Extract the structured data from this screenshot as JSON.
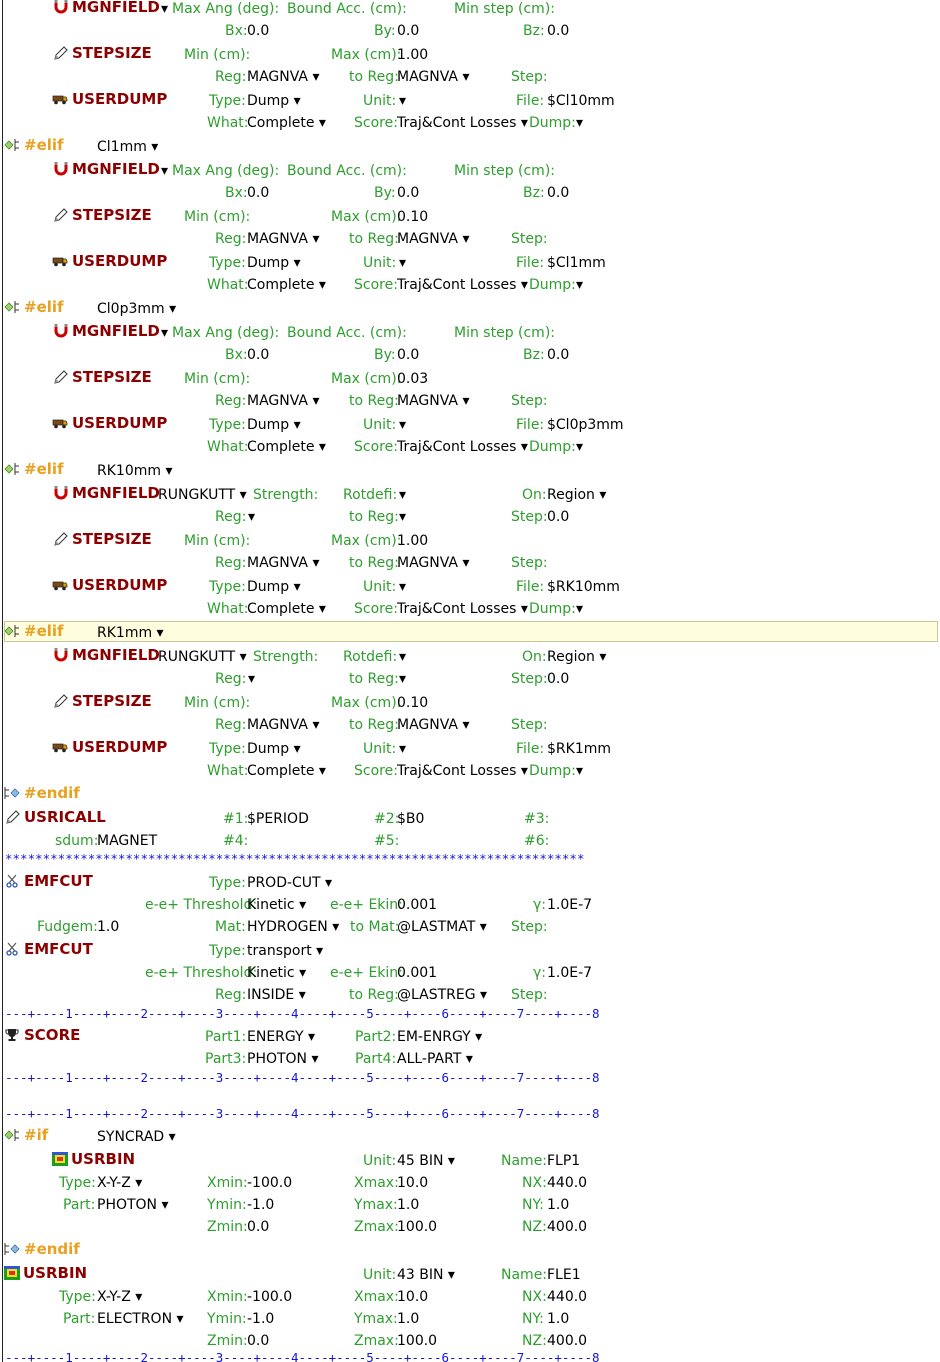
{
  "colors": {
    "keyword": "#8b0000",
    "directive": "#e8a020",
    "label": "#2e9e2e",
    "ruler": "#1515d8",
    "highlight": "#fefedf"
  },
  "icons": {
    "magnet": "magnet-icon",
    "stepsize": "pencil-icon",
    "userdump": "truck-icon",
    "directive": "branch-icon",
    "usricall": "pencil-icon",
    "emfcut": "scissors-icon",
    "score": "trophy-icon",
    "usrbin": "bin-grid-icon"
  },
  "kw": {
    "mgnfield": "MGNFIELD",
    "stepsize": "STEPSIZE",
    "userdump": "USERDUMP",
    "usricall": "USRICALL",
    "emfcut": "EMFCUT",
    "score": "SCORE",
    "usrbin": "USRBIN"
  },
  "dir": {
    "elif": "#elif",
    "endif": "#endif",
    "if": "#if"
  },
  "lab": {
    "maxang": "Max Ang (deg):",
    "boundacc": "Bound Acc. (cm):",
    "minstep": "Min step (cm):",
    "bx": "Bx:",
    "by": "By:",
    "bz": "Bz:",
    "mincm": "Min (cm):",
    "maxcm": "Max (cm):",
    "reg": "Reg:",
    "toreg": "to Reg:",
    "step": "Step:",
    "type": "Type:",
    "unit": "Unit:",
    "file": "File:",
    "what": "What:",
    "score": "Score:",
    "dump": "Dump:",
    "strength": "Strength:",
    "rotdefi": "Rotdefi:",
    "on": "On:",
    "p1": "#1:",
    "p2": "#2:",
    "p3": "#3:",
    "p4": "#4:",
    "p5": "#5:",
    "p6": "#6:",
    "sdum": "sdum:",
    "eth": "e-e+ Threshold:",
    "eekin": "e-e+ Ekin:",
    "gamma": "γ:",
    "fudgem": "Fudgem:",
    "mat": "Mat:",
    "tomat": "to Mat:",
    "part1": "Part1:",
    "part2": "Part2:",
    "part3": "Part3:",
    "part4": "Part4:",
    "name": "Name:",
    "xmin": "Xmin:",
    "xmax": "Xmax:",
    "nx": "NX:",
    "part": "Part:",
    "ymin": "Ymin:",
    "ymax": "Ymax:",
    "ny": "NY:",
    "zmin": "Zmin:",
    "zmax": "Zmax:",
    "nz": "NZ:"
  },
  "val": {
    "zero": "0.0",
    "d1": "▾",
    "magnva": "MAGNVA ▾",
    "dump": "Dump ▾",
    "complete": "Complete ▾",
    "traj": "Traj&Cont Losses ▾",
    "rungkutt": "RUNGKUTT ▾",
    "region": "Region ▾"
  },
  "blocks": [
    {
      "cond": "",
      "max": "1.00",
      "file": "$Cl10mm"
    },
    {
      "cond": "Cl1mm ▾",
      "max": "0.10",
      "file": "$Cl1mm"
    },
    {
      "cond": "Cl0p3mm ▾",
      "max": "0.03",
      "file": "$Cl0p3mm"
    },
    {
      "cond": "RK10mm ▾",
      "max": "1.00",
      "file": "$RK10mm"
    },
    {
      "cond": "RK1mm ▾",
      "max": "0.10",
      "file": "$RK1mm"
    }
  ],
  "usricall": {
    "p1": "$PERIOD",
    "p2": "$B0",
    "sdum": "MAGNET"
  },
  "stars": "*****************************************************************************",
  "ruler": "---+----1----+----2----+----3----+----4----+----5----+----6----+----7----+----8",
  "emfcut1": {
    "type": "PROD-CUT ▾",
    "threshold": "Kinetic ▾",
    "ekin": "0.001",
    "gamma": "1.0E-7",
    "fudgem": "1.0",
    "mat": "HYDROGEN ▾",
    "tomat": "@LASTMAT ▾"
  },
  "emfcut2": {
    "type": "transport ▾",
    "threshold": "Kinetic ▾",
    "ekin": "0.001",
    "gamma": "1.0E-7",
    "reg": "INSIDE ▾",
    "toreg": "@LASTREG ▾"
  },
  "score": {
    "part1": "ENERGY ▾",
    "part2": "EM-ENRGY ▾",
    "part3": "PHOTON ▾",
    "part4": "ALL-PART ▾"
  },
  "ifcond": "SYNCRAD ▾",
  "usrbin1": {
    "unit": "45 BIN ▾",
    "name": "FLP1",
    "type": "X-Y-Z ▾",
    "xmin": "-100.0",
    "xmax": "10.0",
    "nx": "440.0",
    "part": "PHOTON ▾",
    "ymin": "-1.0",
    "ymax": "1.0",
    "ny": "1.0",
    "zmin": "0.0",
    "zmax": "100.0",
    "nz": "400.0"
  },
  "usrbin2": {
    "unit": "43 BIN ▾",
    "name": "FLE1",
    "type": "X-Y-Z ▾",
    "xmin": "-100.0",
    "xmax": "10.0",
    "nx": "440.0",
    "part": "ELECTRON ▾",
    "ymin": "-1.0",
    "ymax": "1.0",
    "ny": "1.0",
    "zmin": "0.0",
    "zmax": "100.0",
    "nz": "400.0"
  }
}
